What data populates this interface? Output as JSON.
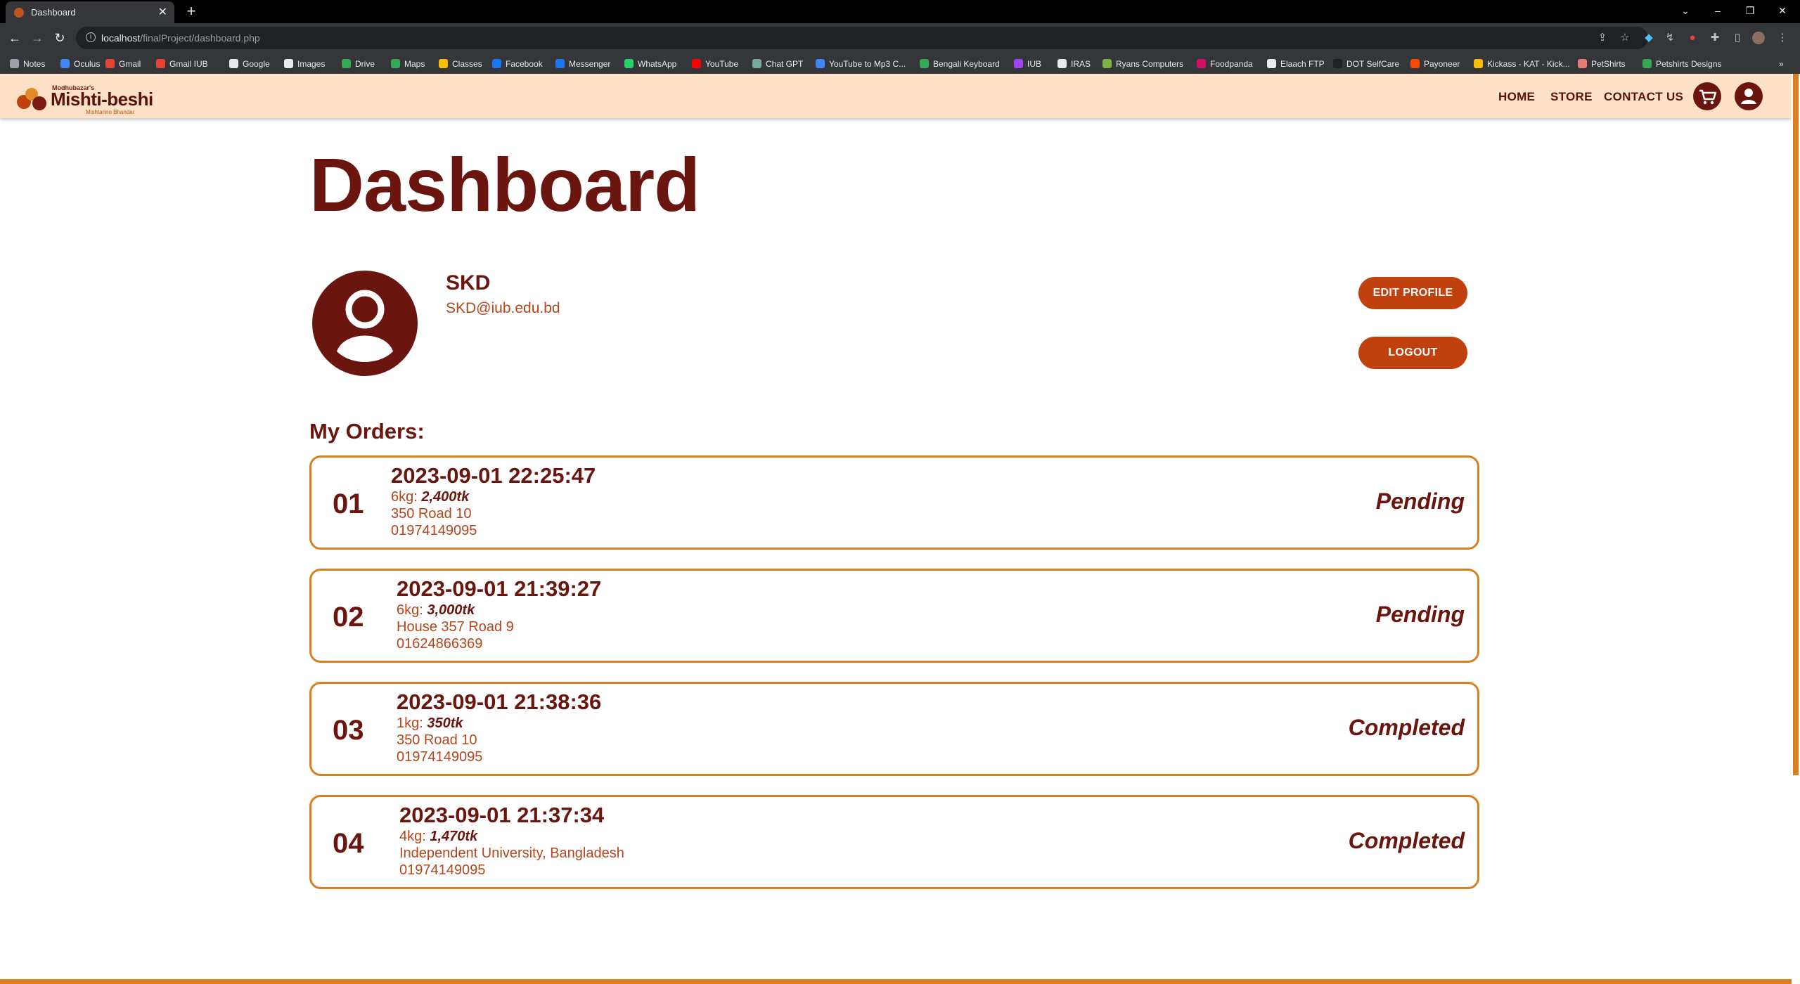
{
  "browser": {
    "tab_title": "Dashboard",
    "url_host": "localhost",
    "url_path": "/finalProject/dashboard.php",
    "bookmarks": [
      {
        "label": "Notes",
        "color": "#9aa0a6"
      },
      {
        "label": "Oculus",
        "color": "#4285f4"
      },
      {
        "label": "Gmail",
        "color": "#ea4335"
      },
      {
        "label": "Gmail IUB",
        "color": "#ea4335"
      },
      {
        "label": "Google",
        "color": "#e8eaed"
      },
      {
        "label": "Images",
        "color": "#e8eaed"
      },
      {
        "label": "Drive",
        "color": "#34a853"
      },
      {
        "label": "Maps",
        "color": "#34a853"
      },
      {
        "label": "Classes",
        "color": "#fbbc04"
      },
      {
        "label": "Facebook",
        "color": "#1877f2"
      },
      {
        "label": "Messenger",
        "color": "#1877f2"
      },
      {
        "label": "WhatsApp",
        "color": "#25d366"
      },
      {
        "label": "YouTube",
        "color": "#ff0000"
      },
      {
        "label": "Chat GPT",
        "color": "#74aa9c"
      },
      {
        "label": "YouTube to Mp3 C...",
        "color": "#4285f4"
      },
      {
        "label": "Bengali Keyboard",
        "color": "#34a853"
      },
      {
        "label": "IUB",
        "color": "#a142f4"
      },
      {
        "label": "IRAS",
        "color": "#e8eaed"
      },
      {
        "label": "Ryans Computers",
        "color": "#7cb342"
      },
      {
        "label": "Foodpanda",
        "color": "#d70f64"
      },
      {
        "label": "Elaach FTP",
        "color": "#e8eaed"
      },
      {
        "label": "DOT SelfCare",
        "color": "#202124"
      },
      {
        "label": "Payoneer",
        "color": "#ff4800"
      },
      {
        "label": "Kickass - KAT - Kick...",
        "color": "#fbbc04"
      },
      {
        "label": "PetShirts",
        "color": "#e67c73"
      },
      {
        "label": "Petshirts Designs",
        "color": "#34a853"
      }
    ]
  },
  "site": {
    "logo_kicker": "Modhubazar's",
    "logo_brand": "Mishti-beshi",
    "logo_tagline": "Mishtanno Bhandar",
    "nav": {
      "home": "HOME",
      "store": "STORE",
      "contact": "CONTACT US"
    },
    "accent": "#d88020",
    "brand_color": "#6b150f",
    "button_color": "#c0400e"
  },
  "dashboard": {
    "title": "Dashboard",
    "user_name": "SKD",
    "user_email": "SKD@iub.edu.bd",
    "edit_profile_label": "EDIT PROFILE",
    "logout_label": "LOGOUT",
    "orders_heading": "My Orders:"
  },
  "orders": [
    {
      "num": "01",
      "date": "2023-09-01 22:25:47",
      "qty": "6kg:",
      "price": "2,400tk",
      "address": "350 Road 10",
      "phone": "01974149095",
      "status": "Pending"
    },
    {
      "num": "02",
      "date": "2023-09-01 21:39:27",
      "qty": "6kg:",
      "price": "3,000tk",
      "address": "House 357 Road 9",
      "phone": "01624866369",
      "status": "Pending"
    },
    {
      "num": "03",
      "date": "2023-09-01 21:38:36",
      "qty": "1kg:",
      "price": "350tk",
      "address": "350 Road 10",
      "phone": "01974149095",
      "status": "Completed"
    },
    {
      "num": "04",
      "date": "2023-09-01 21:37:34",
      "qty": "4kg:",
      "price": "1,470tk",
      "address": "Independent University, Bangladesh",
      "phone": "01974149095",
      "status": "Completed"
    }
  ]
}
